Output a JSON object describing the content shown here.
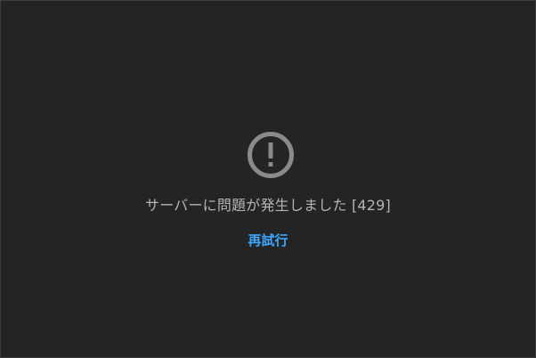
{
  "colors": {
    "background": "#242424",
    "icon": "#8a8a8a",
    "message_text": "#b5b5b5",
    "link": "#3ea6ff"
  },
  "error": {
    "icon": "exclamation-circle-icon",
    "message": "サーバーに問題が発生しました [429]",
    "retry_label": "再試行"
  }
}
